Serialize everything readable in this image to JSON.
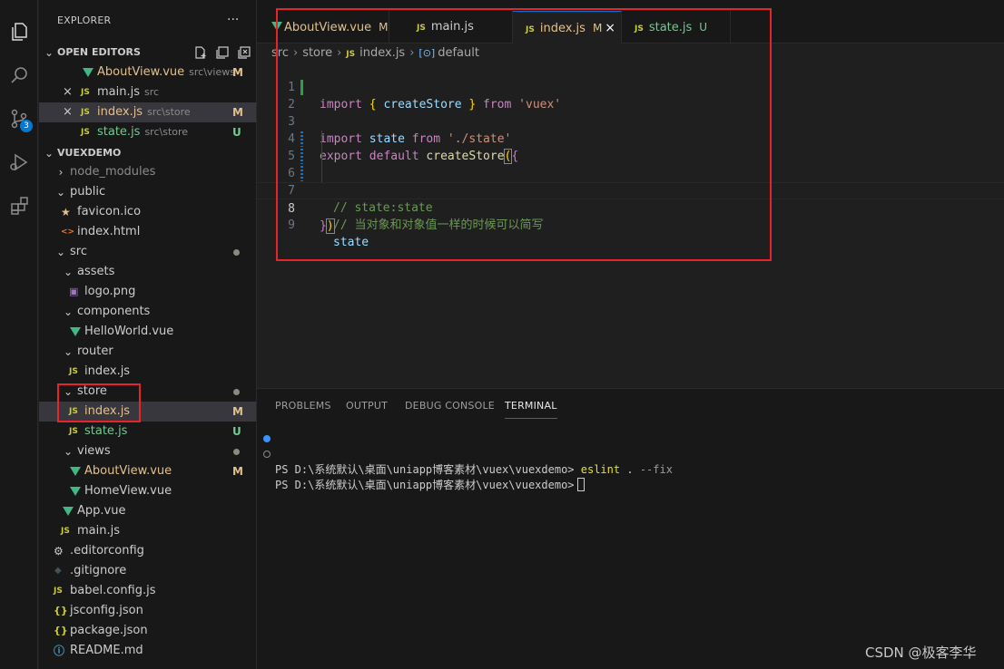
{
  "activity_bar": {
    "items": [
      "files-icon",
      "search-icon",
      "source-control-icon",
      "run-debug-icon",
      "extensions-icon"
    ],
    "source_control_badge": "3"
  },
  "sidebar": {
    "title": "EXPLORER",
    "more": "···",
    "open_editors": {
      "title": "OPEN EDITORS",
      "items": [
        {
          "name": "AboutView.vue",
          "path": "src\\views",
          "status": "M",
          "icon": "vue"
        },
        {
          "name": "main.js",
          "path": "src",
          "status": "",
          "icon": "js",
          "close": "×"
        },
        {
          "name": "index.js",
          "path": "src\\store",
          "status": "M",
          "icon": "js",
          "close": "×"
        },
        {
          "name": "state.js",
          "path": "src\\store",
          "status": "U",
          "icon": "js"
        }
      ]
    },
    "project": {
      "title": "VUEXDEMO",
      "items": [
        {
          "label": "node_modules",
          "twisty": "›"
        },
        {
          "label": "public",
          "twisty": "⌄"
        },
        {
          "label": "favicon.ico",
          "icon": "★"
        },
        {
          "label": "index.html",
          "icon": "<>"
        },
        {
          "label": "src",
          "twisty": "⌄"
        },
        {
          "label": "assets",
          "twisty": "⌄"
        },
        {
          "label": "logo.png",
          "icon": "▣"
        },
        {
          "label": "components",
          "twisty": "⌄"
        },
        {
          "label": "HelloWorld.vue"
        },
        {
          "label": "router",
          "twisty": "⌄"
        },
        {
          "label": "index.js",
          "icon": "JS"
        },
        {
          "label": "store",
          "twisty": "⌄"
        },
        {
          "label": "index.js",
          "icon": "JS",
          "status": "M"
        },
        {
          "label": "state.js",
          "icon": "JS",
          "status": "U"
        },
        {
          "label": "views",
          "twisty": "⌄"
        },
        {
          "label": "AboutView.vue",
          "status": "M"
        },
        {
          "label": "HomeView.vue"
        },
        {
          "label": "App.vue"
        },
        {
          "label": "main.js",
          "icon": "JS"
        },
        {
          "label": ".editorconfig",
          "icon": "⚙"
        },
        {
          "label": ".gitignore",
          "icon": "◆"
        },
        {
          "label": "babel.config.js",
          "icon": "JS"
        },
        {
          "label": "jsconfig.json",
          "icon": "{}"
        },
        {
          "label": "package.json",
          "icon": "{}"
        },
        {
          "label": "README.md",
          "icon": "ⓘ"
        }
      ]
    }
  },
  "editor": {
    "tabs": [
      {
        "label": "AboutView.vue",
        "status": "M",
        "icon": "vue"
      },
      {
        "label": "main.js",
        "status": "",
        "icon": "JS"
      },
      {
        "label": "index.js",
        "status": "M",
        "icon": "JS",
        "close": "×"
      },
      {
        "label": "state.js",
        "status": "U",
        "icon": "JS"
      }
    ],
    "breadcrumb": [
      "src",
      "store",
      "index.js",
      "default"
    ],
    "breadcrumb_js": "JS",
    "breadcrumb_icon": "[⊙]",
    "line_numbers": [
      "1",
      "2",
      "3",
      "4",
      "5",
      "6",
      "7",
      "8",
      "9"
    ],
    "code_tokens": {
      "import": "import",
      "open_brace": "{",
      "createStore": "createStore",
      "close_brace": "}",
      "from": "from",
      "vuex_str": "'vuex'",
      "state": "state",
      "state_str": "'./state'",
      "export": "export",
      "default": "default",
      "paren_open": "(",
      "obj_open": "{",
      "comment1": "// state:state",
      "comment2": "// 当对象和对象值一样的时候可以简写",
      "obj_close": "}",
      "paren_close": ")"
    }
  },
  "panel": {
    "tabs": [
      "PROBLEMS",
      "OUTPUT",
      "DEBUG CONSOLE",
      "TERMINAL"
    ],
    "active_tab": "TERMINAL",
    "terminal": {
      "prompt": "PS D:\\系统默认\\桌面\\uniapp博客素材\\vuex\\vuexdemo>",
      "cmd": "eslint",
      "arg": ".",
      "flag": "--fix"
    }
  },
  "watermark": "CSDN @极客李华",
  "colors": {
    "modified": "#e2c08d",
    "untracked": "#73c991",
    "annotation_box": "#e5252a",
    "accent": "#0078d4"
  }
}
